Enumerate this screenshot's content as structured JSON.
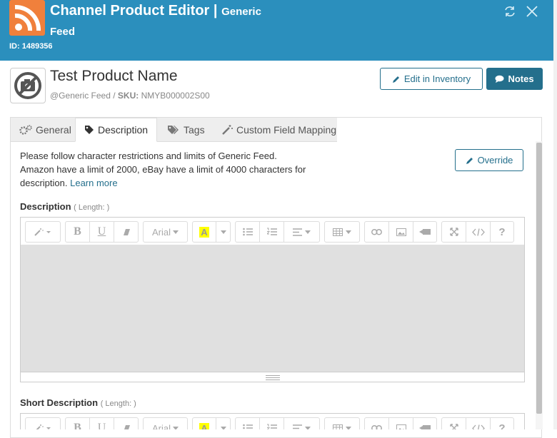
{
  "header": {
    "title": "Channel Product Editor |",
    "title_channel_line1": "Generic",
    "title_channel_line2": "Feed",
    "id_label": "ID: 1489356"
  },
  "product": {
    "name": "Test Product Name",
    "channel": "@Generic Feed",
    "sep": "/",
    "sku_label": "SKU:",
    "sku": "NMYB000002S00"
  },
  "actions": {
    "edit_inventory": "Edit in Inventory",
    "notes": "Notes"
  },
  "tabs": [
    {
      "label": "General",
      "icon": "gears-icon"
    },
    {
      "label": "Description",
      "icon": "tag-icon",
      "active": true
    },
    {
      "label": "Tags",
      "icon": "tags-icon"
    },
    {
      "label": "Custom Field Mapping",
      "icon": "magic-wand-icon"
    }
  ],
  "info": {
    "line1": "Please follow character restrictions and limits of Generic Feed.",
    "line2": "Amazon have a limit of 2000, eBay have a limit of 4000 characters for",
    "line3": "description.",
    "learn_more": "Learn more"
  },
  "override_label": "Override",
  "fields": {
    "description": {
      "label": "Description",
      "length": "( Length: )"
    },
    "short_description": {
      "label": "Short Description",
      "length": "( Length: )"
    }
  },
  "toolbar": {
    "bold": "B",
    "underline": "U",
    "font": "Arial",
    "color_letter": "A",
    "help": "?"
  }
}
